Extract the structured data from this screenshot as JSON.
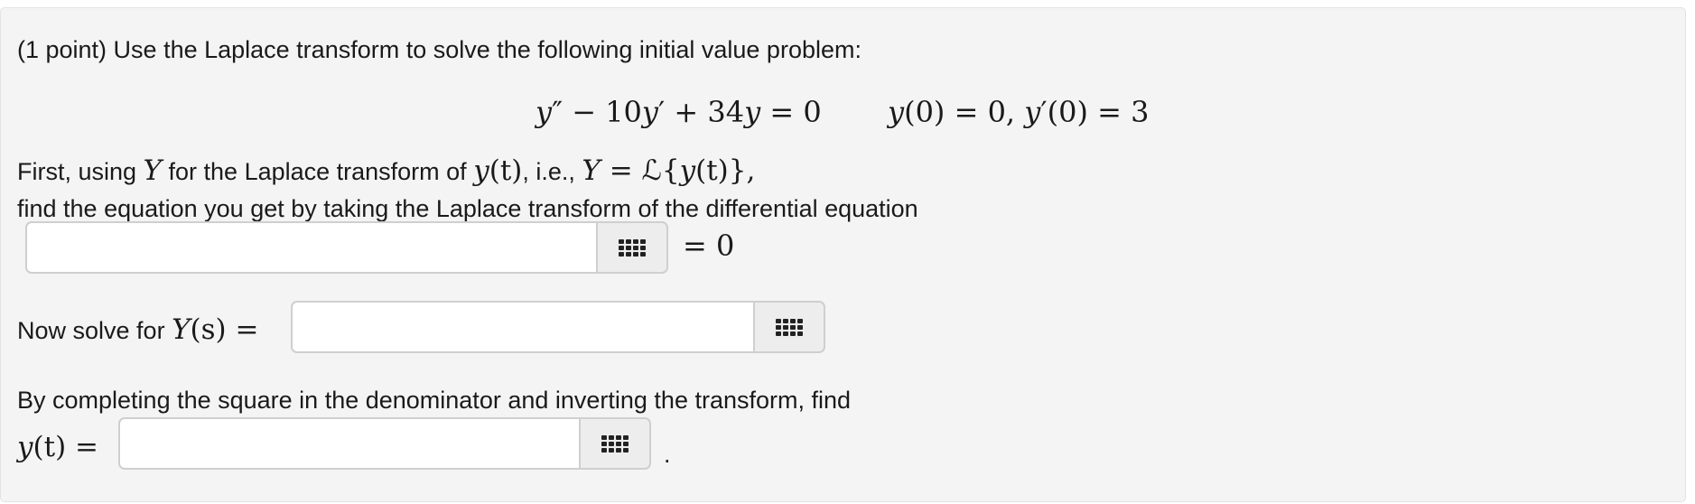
{
  "problem": {
    "intro": "(1 point) Use the Laplace transform to solve the following initial value problem:",
    "equation_lhs_1": "y",
    "equation_prime_1": "″",
    "equation_rest": " − 10",
    "equation_y2": "y",
    "equation_prime_2": "′",
    "equation_plus": " + 34",
    "equation_y3": "y",
    "equation_rhs": " = 0",
    "initial_condition_1": "(0) = 0, ",
    "initial_condition_2": "(0) = 3"
  },
  "step1": {
    "text_a": "First, using ",
    "var_Y": "Y",
    "text_b": " for the Laplace transform of ",
    "var_yt": "y",
    "var_t_paren": "(t)",
    "text_c": ", i.e., ",
    "eq_part": " = ℒ{",
    "eq_end": "},",
    "line2": "find the equation you get by taking the Laplace transform of the differential equation",
    "suffix": "= 0"
  },
  "step2": {
    "label_text": "Now solve for ",
    "var": "Y",
    "var_arg": "(s)",
    "equals": " ="
  },
  "step3": {
    "text": "By completing the square in the denominator and inverting the transform, find",
    "var": "y",
    "var_arg": "(t)",
    "equals": " =",
    "end_period": "."
  },
  "answers": {
    "answer1": "",
    "answer2": "",
    "answer3": ""
  },
  "icons": {
    "equation_editor": "grid-icon"
  }
}
